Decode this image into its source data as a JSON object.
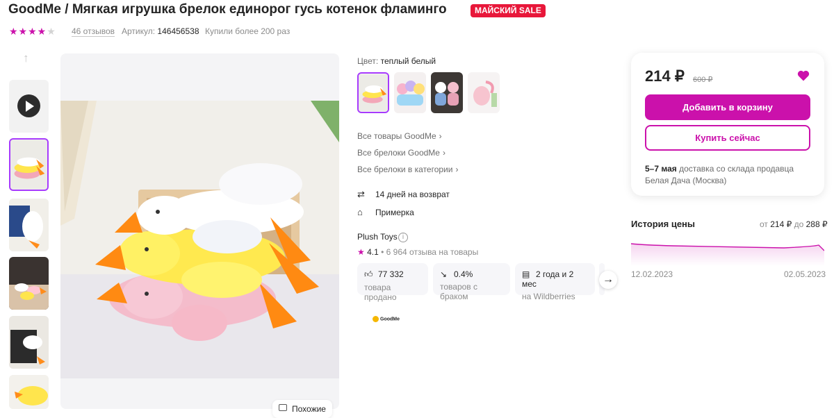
{
  "product": {
    "title": "GoodMe / Мягкая игрушка брелок единорог гусь котенок фламинго",
    "sale_badge": "МАЙСКИЙ SALE",
    "rating_stars": 4,
    "reviews_label": "46 отзывов",
    "article_label": "Артикул:",
    "article_value": "146456538",
    "bought_label": "Купили более 200 раз"
  },
  "gallery": {
    "thumbnails": [
      "video",
      "yellow-duck-stack",
      "duck-pillow-in-room",
      "ducks-on-table",
      "tote-bag-duck",
      "yellow-duck-closeup"
    ],
    "active_index": 1,
    "similar_button": "Похожие"
  },
  "variants": {
    "color_label": "Цвет:",
    "color_value": "теплый белый",
    "swatches": [
      "ducks",
      "unicorns",
      "kittens",
      "flamingo"
    ],
    "active_index": 0
  },
  "links": [
    "Все товары GoodMe",
    "Все брелоки GoodMe",
    "Все брелоки в категории"
  ],
  "features": [
    {
      "icon": "return-arrows-icon",
      "label": "14 дней на возврат"
    },
    {
      "icon": "tag-icon",
      "label": "Примерка"
    }
  ],
  "brand": {
    "name": "Plush Toys",
    "rating": "4.1",
    "reviews": "6 964 отзыва на товары",
    "logo_text": "GoodMe"
  },
  "stats": [
    {
      "icon": "thumbs-up-icon",
      "value": "77 332",
      "label": "товара продано"
    },
    {
      "icon": "trend-down-icon",
      "value": "0.4%",
      "label": "товаров с браком"
    },
    {
      "icon": "calendar-box-icon",
      "value": "2 года и 2 мес",
      "label": "на Wildberries"
    }
  ],
  "buy_box": {
    "price": "214 ₽",
    "old_price": "600 ₽",
    "add_to_cart": "Добавить в корзину",
    "buy_now": "Купить сейчас",
    "delivery_days": "5–7 мая",
    "delivery_text": "доставка со склада продавца",
    "delivery_place": "Белая Дача (Москва)"
  },
  "price_history": {
    "title": "История цены",
    "from_label": "от",
    "min": "214 ₽",
    "to_label": "до",
    "max": "288 ₽",
    "start_date": "12.02.2023",
    "end_date": "02.05.2023"
  },
  "colors": {
    "accent": "#cb11ab",
    "active_border": "#a73afd",
    "sale": "#e8173a"
  }
}
